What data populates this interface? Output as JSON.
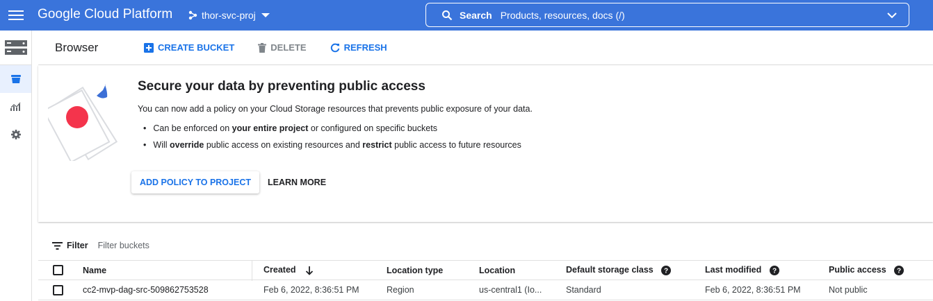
{
  "topbar": {
    "menu_icon": "hamburger-menu-icon",
    "logo_text": "Google Cloud Platform",
    "project_name": "thor-svc-proj",
    "search_label": "Search",
    "search_placeholder": "Products, resources, docs (/)"
  },
  "colors": {
    "topbar_bg": "#3a74db",
    "accent_blue": "#1a73e8",
    "disabled_grey": "#80868b",
    "illustration_red": "#f4344c",
    "illustration_blue": "#3c6fd6"
  },
  "rail": {
    "icons": [
      "storage-icon",
      "bucket-icon",
      "monitoring-icon",
      "settings-icon"
    ]
  },
  "header": {
    "title": "Browser",
    "create_bucket": "CREATE BUCKET",
    "delete": "DELETE",
    "refresh": "REFRESH"
  },
  "promo": {
    "title": "Secure your data by preventing public access",
    "description": "You can now add a policy on your Cloud Storage resources that prevents public exposure of your data.",
    "bullets": [
      {
        "pre": "Can be enforced on ",
        "bold": "your entire project",
        "post": " or configured on specific buckets"
      },
      {
        "pre": "Will ",
        "bold": "override",
        "mid": " public access on existing resources and ",
        "bold2": "restrict",
        "post": " public access to future resources"
      }
    ],
    "add_policy_button": "ADD POLICY TO PROJECT",
    "learn_more_button": "LEARN MORE"
  },
  "filter": {
    "label": "Filter",
    "placeholder": "Filter buckets"
  },
  "table": {
    "columns": [
      "Name",
      "Created",
      "Location type",
      "Location",
      "Default storage class",
      "Last modified",
      "Public access"
    ],
    "rows": [
      {
        "name": "cc2-mvp-dag-src-509862753528",
        "created": "Feb 6, 2022, 8:36:51 PM",
        "location_type": "Region",
        "location": "us-central1 (Io...",
        "storage_class": "Standard",
        "last_modified": "Feb 6, 2022, 8:36:51 PM",
        "public_access": "Not public"
      }
    ]
  }
}
